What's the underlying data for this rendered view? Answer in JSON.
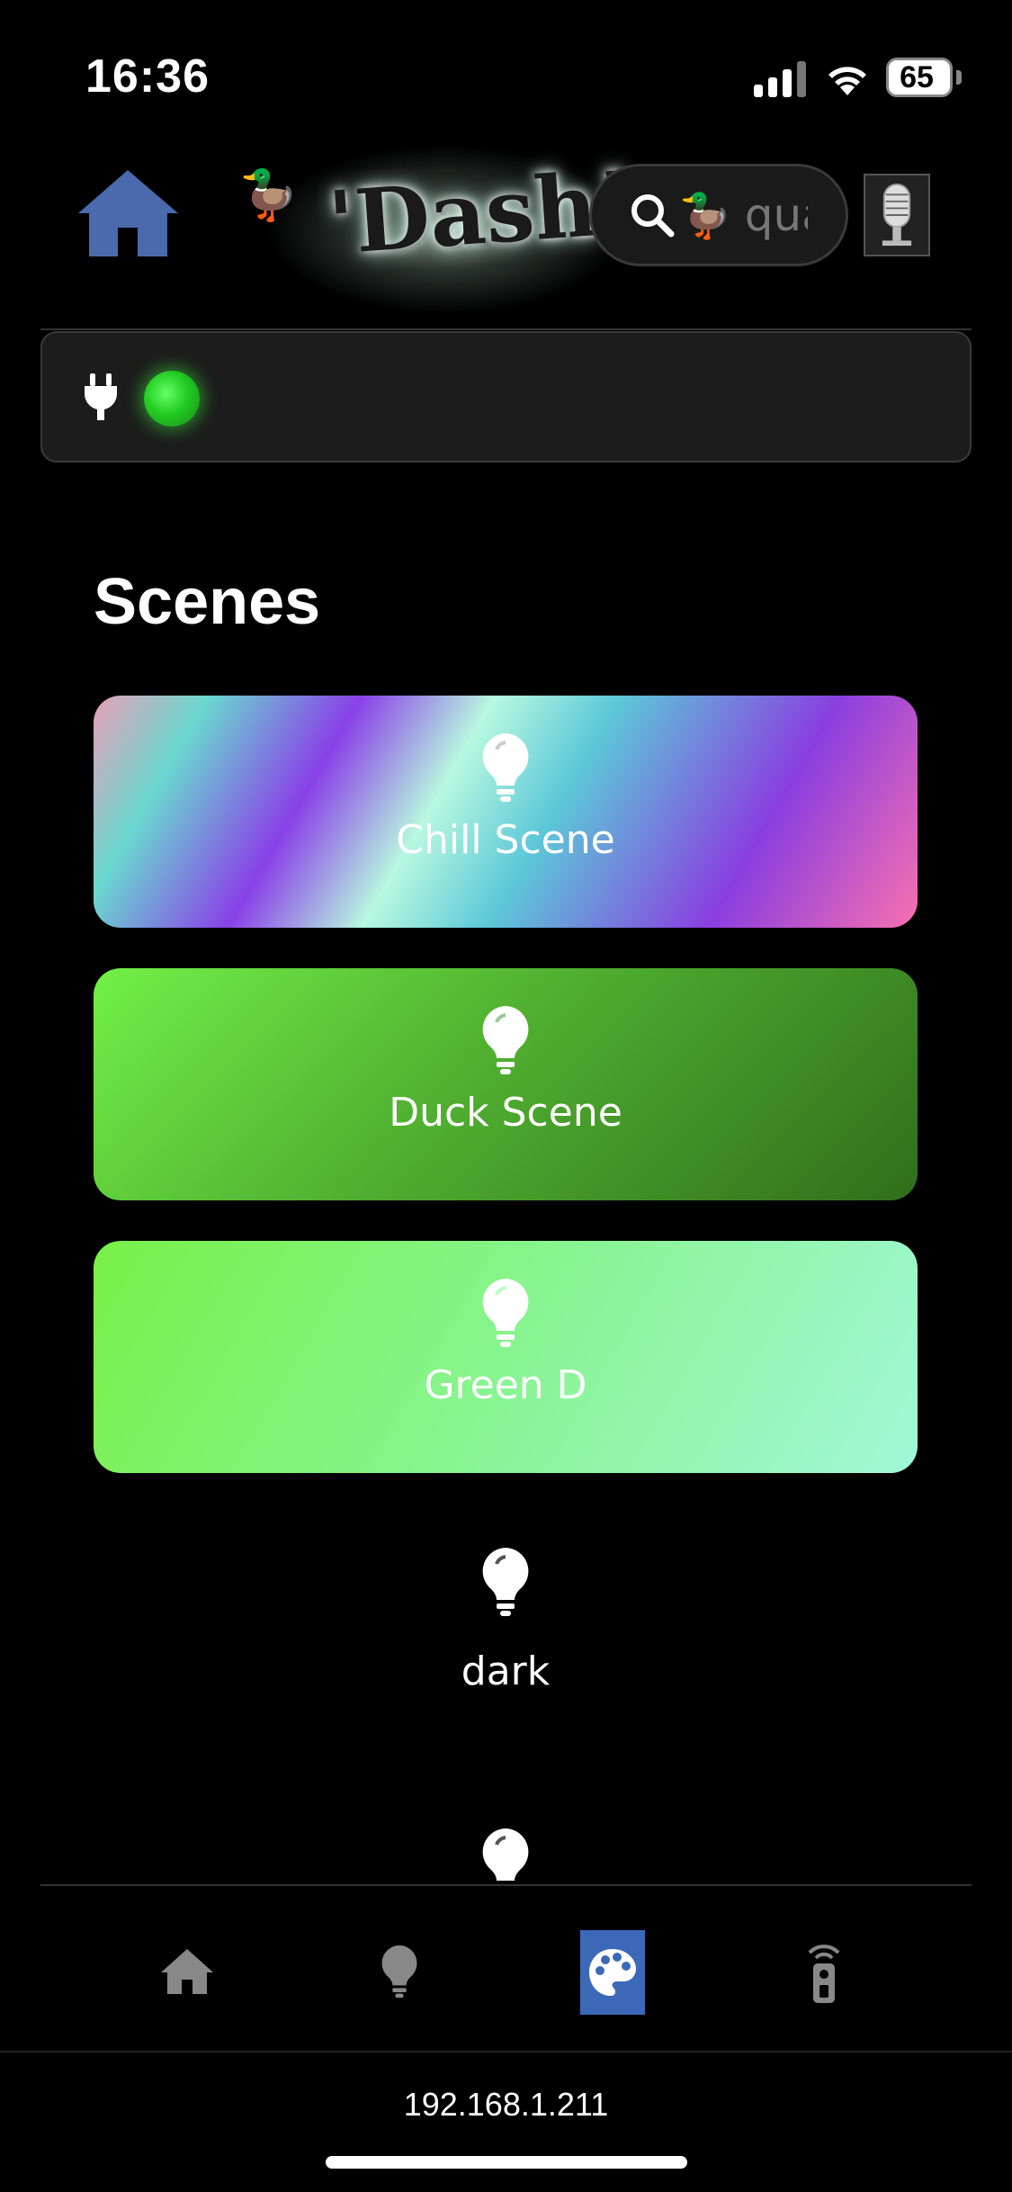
{
  "status_bar": {
    "time": "16:36",
    "battery": "65"
  },
  "header": {
    "logo_text": "'Dash!",
    "search_placeholder": "qua"
  },
  "sections": {
    "scenes_title": "Scenes"
  },
  "scenes": [
    {
      "label": "Chill Scene"
    },
    {
      "label": "Duck Scene"
    },
    {
      "label": "Green D"
    },
    {
      "label": "dark"
    }
  ],
  "footer": {
    "ip": "192.168.1.211"
  },
  "icons": {
    "home": "house-icon",
    "search": "magnifier-icon",
    "mic": "microphone-icon",
    "plug": "plug-icon",
    "bulb": "lightbulb-icon",
    "palette": "palette-icon",
    "remote": "remote-icon"
  },
  "colors": {
    "accent": "#4a6aad",
    "nav_active": "#3c68b8",
    "led": "#33cc33"
  }
}
